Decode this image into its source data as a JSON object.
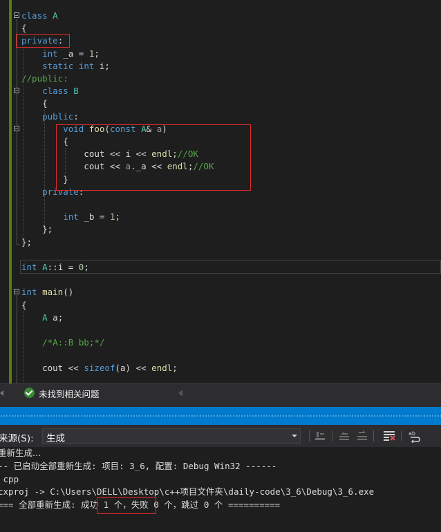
{
  "editor": {
    "lines": [
      [
        {
          "t": "class",
          "c": "kw"
        },
        {
          "t": " A",
          "c": "typ"
        }
      ],
      [
        {
          "t": "{",
          "c": ""
        }
      ],
      [
        {
          "t": "private",
          "c": "kw"
        },
        {
          "t": ":",
          "c": ""
        }
      ],
      [
        {
          "t": "    int",
          "c": "kw"
        },
        {
          "t": " _a = ",
          "c": "mem"
        },
        {
          "t": "1",
          "c": "num"
        },
        {
          "t": ";",
          "c": ""
        }
      ],
      [
        {
          "t": "    static",
          "c": "kw"
        },
        {
          "t": " int",
          "c": "kw"
        },
        {
          "t": " i;",
          "c": ""
        }
      ],
      [
        {
          "t": "//public:",
          "c": "cmt"
        }
      ],
      [
        {
          "t": "    class",
          "c": "kw"
        },
        {
          "t": " B",
          "c": "typ"
        }
      ],
      [
        {
          "t": "    {",
          "c": ""
        }
      ],
      [
        {
          "t": "    public",
          "c": "kw"
        },
        {
          "t": ":",
          "c": ""
        }
      ],
      [
        {
          "t": "        void",
          "c": "kw"
        },
        {
          "t": " foo",
          "c": "fn"
        },
        {
          "t": "(",
          "c": ""
        },
        {
          "t": "const",
          "c": "kw"
        },
        {
          "t": " A",
          "c": "typ"
        },
        {
          "t": "& ",
          "c": ""
        },
        {
          "t": "a",
          "c": "par"
        },
        {
          "t": ")",
          "c": ""
        }
      ],
      [
        {
          "t": "        {",
          "c": ""
        }
      ],
      [
        {
          "t": "            cout << i << ",
          "c": ""
        },
        {
          "t": "endl",
          "c": "fn"
        },
        {
          "t": ";",
          "c": ""
        },
        {
          "t": "//OK",
          "c": "cmt"
        }
      ],
      [
        {
          "t": "            cout << ",
          "c": ""
        },
        {
          "t": "a",
          "c": "par"
        },
        {
          "t": "._a << ",
          "c": ""
        },
        {
          "t": "endl",
          "c": "fn"
        },
        {
          "t": ";",
          "c": ""
        },
        {
          "t": "//OK",
          "c": "cmt"
        }
      ],
      [
        {
          "t": "        }",
          "c": ""
        }
      ],
      [
        {
          "t": "    private",
          "c": "kw"
        },
        {
          "t": ":",
          "c": ""
        }
      ],
      [],
      [
        {
          "t": "        int",
          "c": "kw"
        },
        {
          "t": " _b = ",
          "c": "mem"
        },
        {
          "t": "1",
          "c": "num"
        },
        {
          "t": ";",
          "c": ""
        }
      ],
      [
        {
          "t": "    };",
          "c": ""
        }
      ],
      [
        {
          "t": "};",
          "c": ""
        }
      ],
      [],
      [
        {
          "t": "int",
          "c": "kw"
        },
        {
          "t": " A",
          "c": "typ"
        },
        {
          "t": "::i = ",
          "c": ""
        },
        {
          "t": "0",
          "c": "num"
        },
        {
          "t": ";",
          "c": ""
        }
      ],
      [],
      [
        {
          "t": "int",
          "c": "kw"
        },
        {
          "t": " main",
          "c": "fn"
        },
        {
          "t": "()",
          "c": ""
        }
      ],
      [
        {
          "t": "{",
          "c": ""
        }
      ],
      [
        {
          "t": "    A",
          "c": "typ"
        },
        {
          "t": " a;",
          "c": ""
        }
      ],
      [],
      [
        {
          "t": "    /*A::B bb;*/",
          "c": "cmt"
        }
      ],
      [],
      [
        {
          "t": "    cout << ",
          "c": ""
        },
        {
          "t": "sizeof",
          "c": "kw"
        },
        {
          "t": "(",
          "c": ""
        },
        {
          "t": "a",
          "c": ""
        },
        {
          "t": ") << ",
          "c": ""
        },
        {
          "t": "endl",
          "c": "fn"
        },
        {
          "t": ";",
          "c": ""
        }
      ]
    ]
  },
  "status": {
    "message": "未找到相关问题",
    "ok_icon": "check-circle-icon",
    "ok_color": "#388a34"
  },
  "output": {
    "source_label": "来源(S):",
    "source_value": "生成",
    "lines": [
      "重新生成…",
      "-- 已启动全部重新生成: 项目: 3_6, 配置: Debug Win32 ------",
      " cpp",
      "cxproj -> C:\\Users\\DELL\\Desktop\\c++项目文件夹\\daily-code\\3_6\\Debug\\3_6.exe",
      "=== 全部重新生成: 成功 1 个，失败 0 个，跳过 0 个 =========="
    ]
  },
  "colors": {
    "keyword": "#569cd6",
    "type": "#4ec9b0",
    "function": "#dcdcaa",
    "comment": "#57a64a",
    "number": "#b5cea8",
    "highlight_box": "#e02b2b",
    "accent_band": "#007acc"
  }
}
